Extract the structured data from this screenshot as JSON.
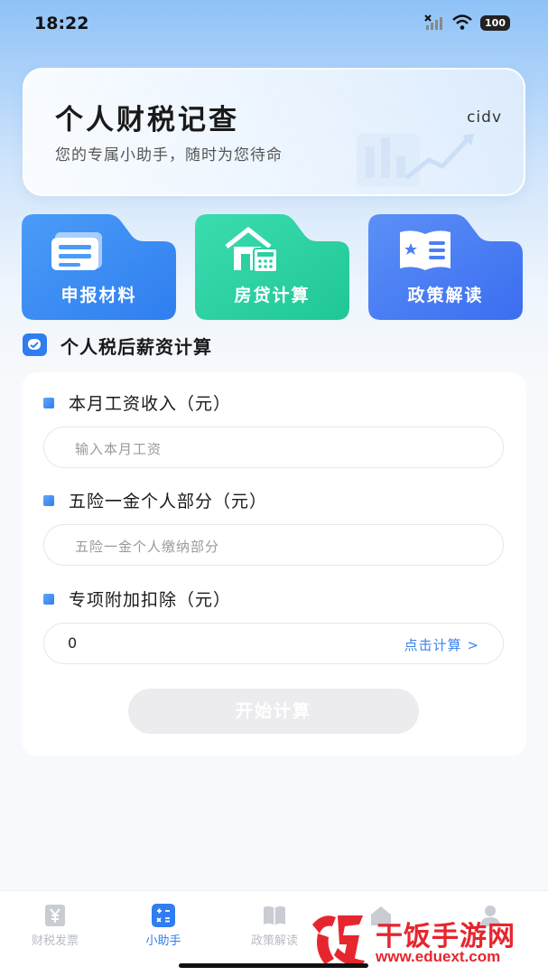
{
  "status_bar": {
    "time": "18:22",
    "battery": "100",
    "icons": [
      "no-signal-icon",
      "wifi-icon",
      "battery-icon"
    ]
  },
  "hero": {
    "title": "个人财税记查",
    "subtitle": "您的专属小助手，随时为您待命",
    "user": "cidv"
  },
  "tiles": [
    {
      "label": "申报材料",
      "icon": "documents-icon",
      "color": "#3e8cf2"
    },
    {
      "label": "房贷计算",
      "icon": "house-calculator-icon",
      "color": "#2fd1a4"
    },
    {
      "label": "政策解读",
      "icon": "policy-book-icon",
      "color": "#4a7ff4"
    }
  ],
  "section": {
    "title": "个人税后薪资计算",
    "icon": "wallet-icon"
  },
  "form": {
    "fields": [
      {
        "label": "本月工资收入（元）",
        "placeholder": "输入本月工资",
        "value": ""
      },
      {
        "label": "五险一金个人部分（元）",
        "placeholder": "五险一金个人缴纳部分",
        "value": ""
      },
      {
        "label": "专项附加扣除（元）",
        "placeholder": "",
        "value": "0",
        "action": "点击计算 >"
      }
    ],
    "submit_label": "开始计算"
  },
  "bottom_nav": {
    "items": [
      {
        "label": "财税发票",
        "icon": "yen-invoice-icon",
        "active": false
      },
      {
        "label": "小助手",
        "icon": "calculator-icon",
        "active": true
      },
      {
        "label": "政策解读",
        "icon": "book-icon",
        "active": false
      },
      {
        "label": "",
        "icon": "home-icon",
        "active": false
      },
      {
        "label": "",
        "icon": "person-icon",
        "active": false
      }
    ]
  },
  "watermark": {
    "title": "干饭手游网",
    "url": "www.eduext.com"
  },
  "colors": {
    "accent": "#2f7df0",
    "tile_blue": "#3e8cf2",
    "tile_green": "#2fd1a4",
    "watermark_red": "#e6262e"
  }
}
